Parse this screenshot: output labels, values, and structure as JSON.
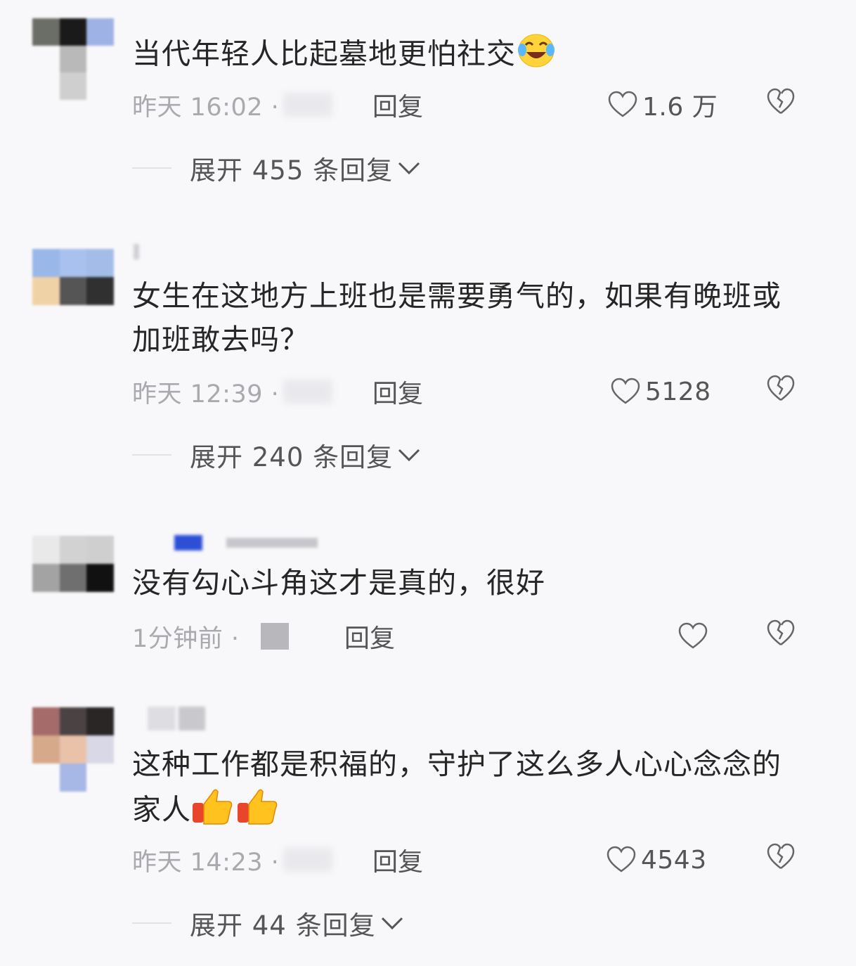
{
  "comments": [
    {
      "text": "当代年轻人比起墓地更怕社交",
      "emoji": "laugh-cry-emoji",
      "time": "昨天 16:02 ·",
      "reply_label": "回复",
      "likes": "1.6 万",
      "expand": "展开 455 条回复"
    },
    {
      "text": "女生在这地方上班也是需要勇气的，如果有晚班或加班敢去吗？",
      "time": "昨天 12:39 ·",
      "reply_label": "回复",
      "likes": "5128",
      "expand": "展开 240 条回复"
    },
    {
      "text": "没有勾心斗角这才是真的，很好",
      "time": "1分钟前 ·",
      "reply_label": "回复",
      "likes": ""
    },
    {
      "text": "这种工作都是积福的，守护了这么多人心心念念的家人",
      "emoji": "thumbs-up-emoji",
      "time": "昨天 14:23 ·",
      "reply_label": "回复",
      "likes": "4543",
      "expand": "展开 44 条回复"
    }
  ],
  "colors": {
    "background": "#f8f8fa",
    "text": "#262626",
    "meta": "#a9a9ae"
  }
}
